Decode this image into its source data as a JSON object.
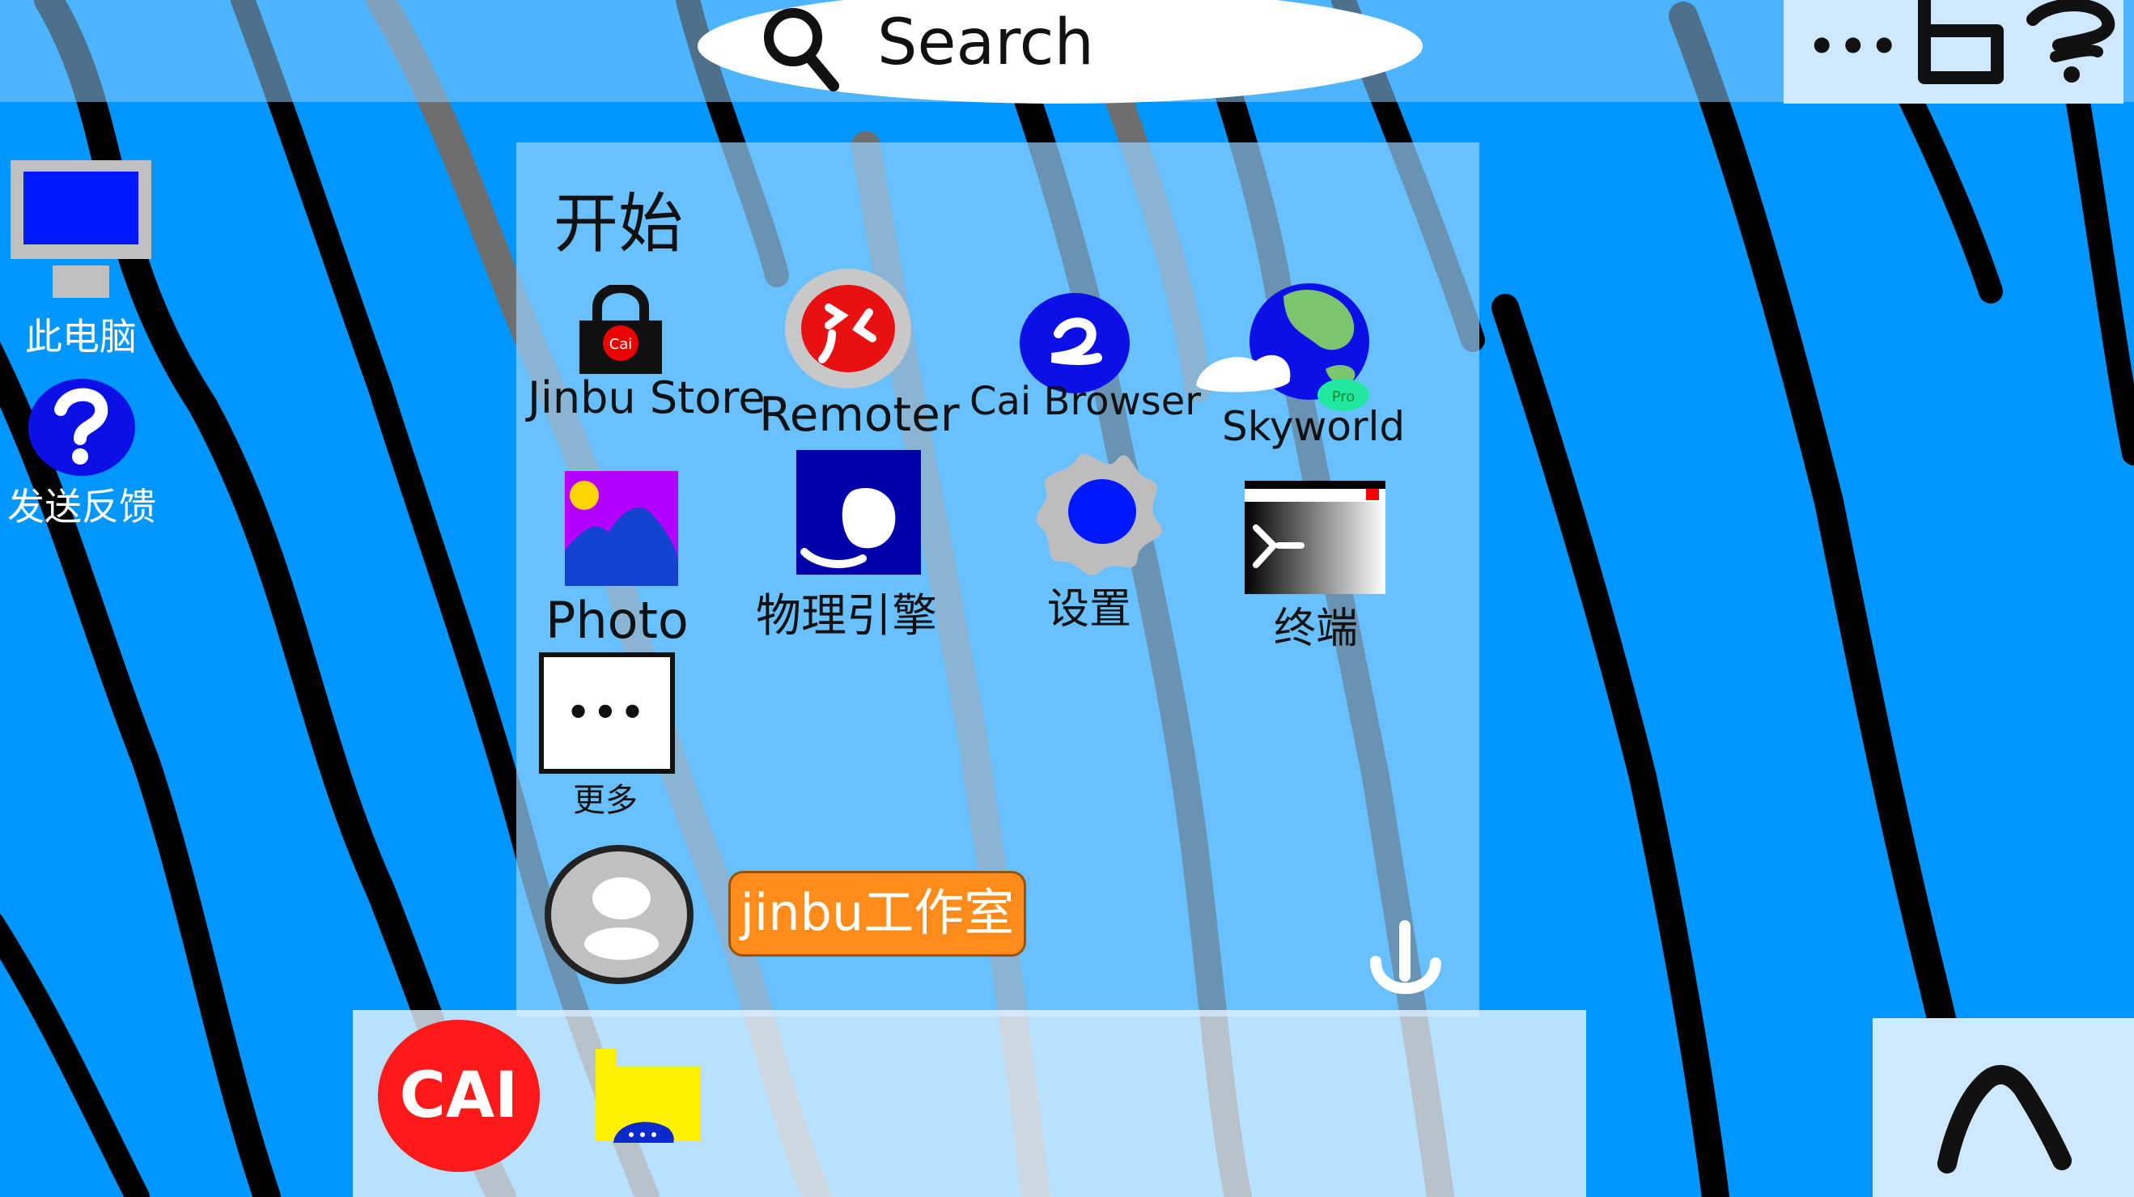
{
  "topbar": {
    "search_label": "Search",
    "search_icon": "search-icon",
    "more_label": "•••",
    "right_icons": [
      "notification-icon",
      "help-icon"
    ]
  },
  "desktop": {
    "icons": [
      {
        "label": "此电脑",
        "icon": "monitor-icon"
      },
      {
        "label": "发送反馈",
        "icon": "help-icon"
      }
    ]
  },
  "start_menu": {
    "title": "开始",
    "apps": [
      {
        "label": "Jinbu Store",
        "icon": "store-bag-icon"
      },
      {
        "label": "Remoter",
        "icon": "remoter-icon"
      },
      {
        "label": "Cai Browser",
        "icon": "browser-icon"
      },
      {
        "label": "Skyworld",
        "icon": "globe-icon",
        "badge": "Pro"
      },
      {
        "label": "Photo",
        "icon": "photo-icon"
      },
      {
        "label": "物理引擎",
        "icon": "physics-engine-icon"
      },
      {
        "label": "设置",
        "icon": "gear-icon"
      },
      {
        "label": "终端",
        "icon": "terminal-icon"
      },
      {
        "label": "更多",
        "icon": "more-icon",
        "glyph": "•••"
      }
    ],
    "user": {
      "name": "jinbu工作室",
      "icon": "avatar-icon"
    },
    "power_icon": "power-icon",
    "store_logo_text": "Cai"
  },
  "taskbar": {
    "items": [
      {
        "icon": "cai-logo-icon",
        "text": "CAI"
      },
      {
        "icon": "folder-icon"
      }
    ],
    "tray_icon": "chevron-up-icon"
  },
  "colors": {
    "wallpaper": "#0096FF",
    "panel": "#96D2FF",
    "accent_orange": "#FF8C1A",
    "logo_red": "#FF1A1A",
    "folder_yellow": "#FFF200",
    "blue": "#0A10E6"
  }
}
